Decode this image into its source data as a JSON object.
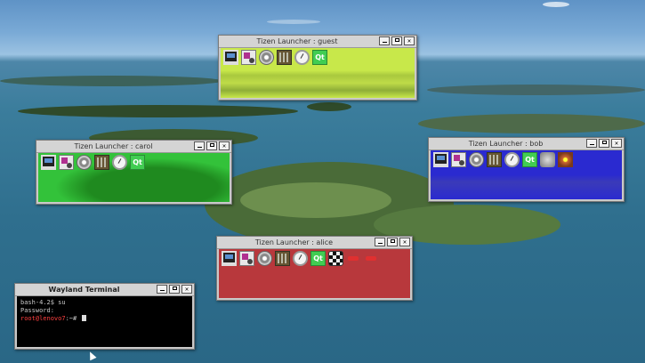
{
  "windows": {
    "guest": {
      "title": "Tizen Launcher : guest",
      "tint": "#c8e84a"
    },
    "carol": {
      "title": "Tizen Launcher : carol",
      "tint": "#33c23a"
    },
    "bob": {
      "title": "Tizen Launcher : bob",
      "tint": "#2a2ad0"
    },
    "alice": {
      "title": "Tizen Launcher : alice",
      "tint": "#b8383c"
    }
  },
  "app_icons": [
    "terminal-icon",
    "paint-icon",
    "settings-icon",
    "calculator-icon",
    "clock-icon",
    "qt-icon",
    "chess-icon",
    "flower-icon",
    "flag-icon",
    "grayscale-icon"
  ],
  "qt_label": "Qt",
  "terminal": {
    "title": "Wayland Terminal",
    "line1": "bash-4.2$ su",
    "line2": "Password:",
    "prompt_user": "root@lenovo7",
    "prompt_rest": ":~# "
  }
}
